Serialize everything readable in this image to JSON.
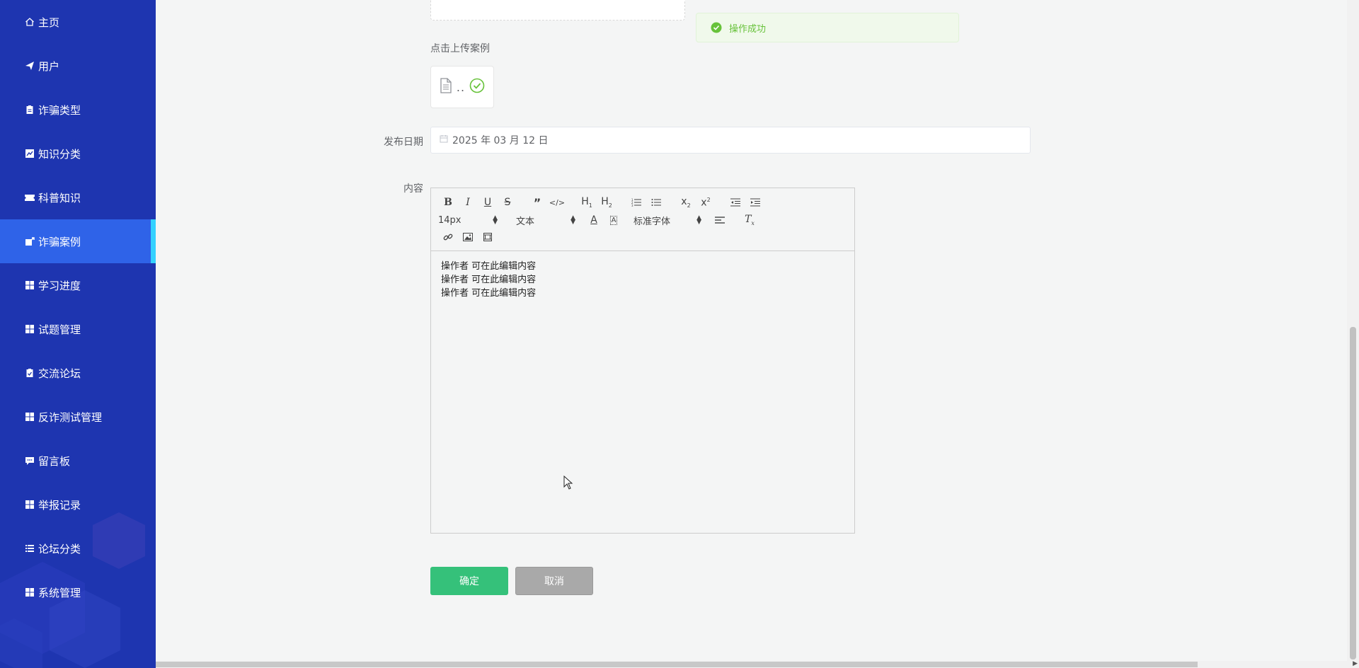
{
  "sidebar": {
    "items": [
      {
        "label": "主页",
        "icon": "home-icon"
      },
      {
        "label": "用户",
        "icon": "paper-plane-icon"
      },
      {
        "label": "诈骗类型",
        "icon": "clipboard-icon"
      },
      {
        "label": "知识分类",
        "icon": "line-chart-icon"
      },
      {
        "label": "科普知识",
        "icon": "ticket-icon"
      },
      {
        "label": "诈骗案例",
        "icon": "share-square-icon",
        "active": true
      },
      {
        "label": "学习进度",
        "icon": "grid-icon"
      },
      {
        "label": "试题管理",
        "icon": "grid-icon"
      },
      {
        "label": "交流论坛",
        "icon": "clipboard-check-icon"
      },
      {
        "label": "反诈测试管理",
        "icon": "grid-icon"
      },
      {
        "label": "留言板",
        "icon": "comment-icon"
      },
      {
        "label": "举报记录",
        "icon": "grid-icon"
      },
      {
        "label": "论坛分类",
        "icon": "list-icon"
      },
      {
        "label": "系统管理",
        "icon": "grid-icon"
      }
    ]
  },
  "form": {
    "upload_hint": "点击上传案例",
    "file_name": "..",
    "date_label": "发布日期",
    "date_value": "2025 年 03 月 12 日",
    "content_label": "内容"
  },
  "editor": {
    "font_size": "14px",
    "header_select": "文本",
    "font_family": "标准字体",
    "content_lines": [
      "操作者  可在此编辑内容",
      "操作者  可在此编辑内容",
      "操作者  可在此编辑内容"
    ]
  },
  "buttons": {
    "confirm": "确定",
    "cancel": "取消"
  },
  "toast": {
    "message": "操作成功"
  },
  "colors": {
    "sidebar_bg": "#1e35b0",
    "sidebar_active": "#2f63e8",
    "active_indicator": "#33d1ff",
    "confirm_button": "#35c17a",
    "cancel_button": "#a9a9a9",
    "success": "#67c23a"
  }
}
